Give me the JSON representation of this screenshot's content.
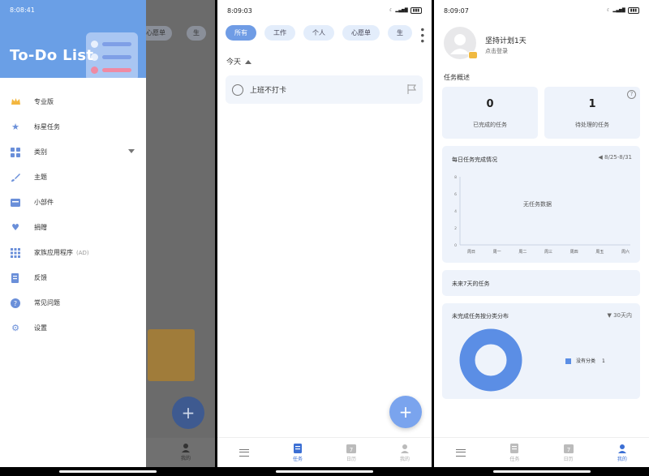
{
  "screen1": {
    "status_time": "8:08:41",
    "app_title": "To-Do List",
    "bg_chips": [
      "心愿单",
      "生"
    ],
    "bg_nav_me": "我的",
    "menu": [
      {
        "icon": "crown-icon",
        "label": "专业版"
      },
      {
        "icon": "star-icon",
        "label": "标星任务"
      },
      {
        "icon": "category-icon",
        "label": "类别"
      },
      {
        "icon": "brush-icon",
        "label": "主题"
      },
      {
        "icon": "widget-icon",
        "label": "小部件"
      },
      {
        "icon": "heart-icon",
        "label": "捐赠"
      },
      {
        "icon": "grid-icon",
        "label": "家族应用程序",
        "tag": "(AD)"
      },
      {
        "icon": "feedback-icon",
        "label": "反馈"
      },
      {
        "icon": "question-icon",
        "label": "常见问题"
      },
      {
        "icon": "gear-icon",
        "label": "设置"
      }
    ]
  },
  "screen2": {
    "status_time": "8:09:03",
    "chips": [
      "所有",
      "工作",
      "个人",
      "心愿单",
      "生"
    ],
    "section": "今天",
    "task": "上班不打卡",
    "nav": [
      "",
      "任务",
      "日历",
      "我的"
    ]
  },
  "screen3": {
    "status_time": "8:09:07",
    "profile_title": "坚持计划1天",
    "profile_sub": "点击登录",
    "overview_label": "任务概述",
    "completed_count": "0",
    "completed_label": "已完成的任务",
    "pending_count": "1",
    "pending_label": "待处理的任务",
    "daily_title": "每日任务完成情况",
    "daily_range": "8/25-8/31",
    "no_data": "无任务数据",
    "future_title": "未来7天的任务",
    "category_title": "未完成任务按分类分布",
    "category_range": "30天内",
    "legend_label": "没有分类",
    "legend_value": "1",
    "nav": [
      "",
      "任务",
      "日历",
      "我的"
    ]
  },
  "chart_data": [
    {
      "type": "bar",
      "title": "每日任务完成情况",
      "categories": [
        "周日",
        "周一",
        "周二",
        "周三",
        "周四",
        "周五",
        "周六"
      ],
      "y_ticks": [
        "8",
        "6",
        "4",
        "2",
        "0"
      ],
      "values": [],
      "ylim": [
        0,
        8
      ]
    },
    {
      "type": "pie",
      "title": "未完成任务按分类分布",
      "labels": [
        "没有分类"
      ],
      "values": [
        1
      ],
      "colors": [
        "#5b8ee5"
      ]
    }
  ]
}
